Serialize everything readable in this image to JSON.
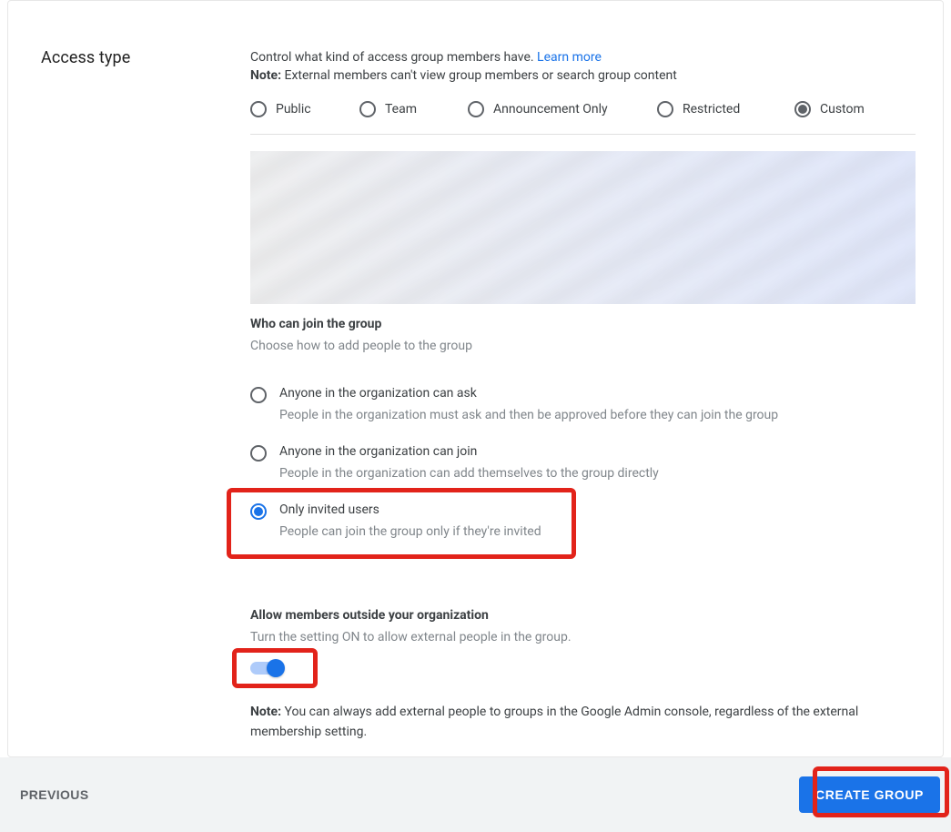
{
  "section": {
    "title": "Access type",
    "intro_lead": "Control what kind of access group members have.",
    "learn_more": "Learn more",
    "note_label": "Note:",
    "note_text": "External members can't view group members or search group content"
  },
  "access_radios": [
    {
      "id": "public",
      "label": "Public",
      "selected": false
    },
    {
      "id": "team",
      "label": "Team",
      "selected": false
    },
    {
      "id": "announcement",
      "label": "Announcement Only",
      "selected": false
    },
    {
      "id": "restricted",
      "label": "Restricted",
      "selected": false
    },
    {
      "id": "custom",
      "label": "Custom",
      "selected": true
    }
  ],
  "join": {
    "title": "Who can join the group",
    "desc": "Choose how to add people to the group",
    "options": [
      {
        "id": "anyone-ask",
        "label": "Anyone in the organization can ask",
        "desc": "People in the organization must ask and then be approved before they can join the group",
        "selected": false
      },
      {
        "id": "anyone-join",
        "label": "Anyone in the organization can join",
        "desc": "People in the organization can add themselves to the group directly",
        "selected": false
      },
      {
        "id": "invited-only",
        "label": "Only invited users",
        "desc": "People can join the group only if they're invited",
        "selected": true
      }
    ]
  },
  "allow_external": {
    "title": "Allow members outside your organization",
    "desc": "Turn the setting ON to allow external people in the group.",
    "on": true,
    "note_label": "Note:",
    "note_text": "You can always add external people to groups in the Google Admin console, regardless of the external membership setting."
  },
  "footer": {
    "previous": "PREVIOUS",
    "create": "CREATE GROUP"
  }
}
